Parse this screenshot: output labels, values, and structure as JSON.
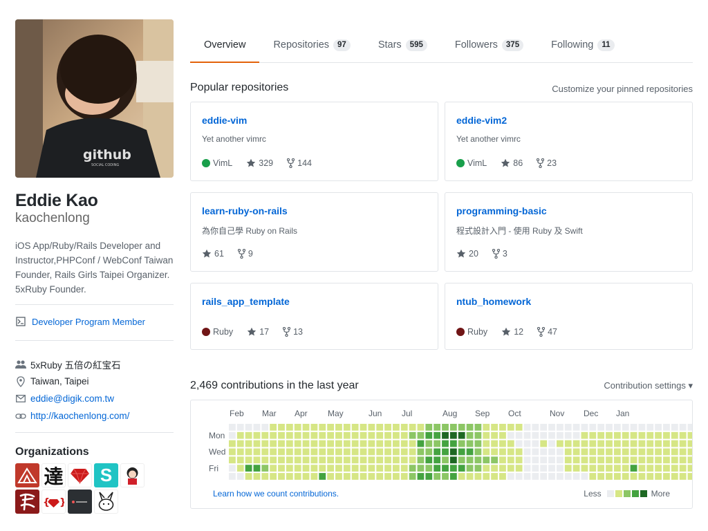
{
  "profile": {
    "fullname": "Eddie Kao",
    "login": "kaochenlong",
    "bio": "iOS App/Ruby/Rails Developer and Instructor,PHPConf / WebConf Taiwan Founder, Rails Girls Taipei Organizer. 5xRuby Founder.",
    "developer_program": "Developer Program Member",
    "avatar_text": "github",
    "avatar_subtext": "SOCIAL CODING",
    "vcard": {
      "company": "5xRuby 五倍の紅宝石",
      "location": "Taiwan, Taipei",
      "email": "eddie@digik.com.tw",
      "website": "http://kaochenlong.com/"
    },
    "organizations_title": "Organizations",
    "organizations": [
      {
        "text": "",
        "color": "#c0392b",
        "icon": "mountain-logo-icon"
      },
      {
        "text": "達",
        "color": "#ffffff",
        "icon": "da-character-logo"
      },
      {
        "text": "",
        "color": "#ffffff",
        "icon": "ruby-gem-icon"
      },
      {
        "text": "S",
        "color": "#20c4c4",
        "icon": "s-logo-icon"
      },
      {
        "text": "",
        "color": "#ffffff",
        "icon": "cartoon-girl-logo"
      },
      {
        "text": "",
        "color": "#8b1a1a",
        "icon": "calligraphy-logo"
      },
      {
        "text": "{ }",
        "color": "#ffffff",
        "icon": "ruby-braces-logo"
      },
      {
        "text": "",
        "color": "#2b2f33",
        "icon": "dark-app-logo"
      },
      {
        "text": "",
        "color": "#ffffff",
        "icon": "rabbit-logo"
      }
    ]
  },
  "tabs": [
    {
      "label": "Overview",
      "count": "",
      "selected": true
    },
    {
      "label": "Repositories",
      "count": "97"
    },
    {
      "label": "Stars",
      "count": "595"
    },
    {
      "label": "Followers",
      "count": "375"
    },
    {
      "label": "Following",
      "count": "11"
    }
  ],
  "pinned": {
    "title": "Popular repositories",
    "customize": "Customize your pinned repositories",
    "repos": [
      {
        "name": "eddie-vim",
        "desc": "Yet another vimrc",
        "lang": "VimL",
        "lang_color": "#199f4b",
        "stars": "329",
        "forks": "144"
      },
      {
        "name": "eddie-vim2",
        "desc": "Yet another vimrc",
        "lang": "VimL",
        "lang_color": "#199f4b",
        "stars": "86",
        "forks": "23"
      },
      {
        "name": "learn-ruby-on-rails",
        "desc": "為你自己學 Ruby on Rails",
        "lang": "",
        "lang_color": "",
        "stars": "61",
        "forks": "9"
      },
      {
        "name": "programming-basic",
        "desc": "程式設計入門 - 使用 Ruby 及 Swift",
        "lang": "",
        "lang_color": "",
        "stars": "20",
        "forks": "3"
      },
      {
        "name": "rails_app_template",
        "desc": "",
        "lang": "Ruby",
        "lang_color": "#701516",
        "stars": "17",
        "forks": "13"
      },
      {
        "name": "ntub_homework",
        "desc": "",
        "lang": "Ruby",
        "lang_color": "#701516",
        "stars": "12",
        "forks": "47"
      }
    ]
  },
  "contributions": {
    "title": "2,469 contributions in the last year",
    "settings": "Contribution settings ▾",
    "learn": "Learn how we count contributions.",
    "less": "Less",
    "more": "More",
    "months": [
      "Feb",
      "Mar",
      "Apr",
      "May",
      "Jun",
      "Jul",
      "Aug",
      "Sep",
      "Oct",
      "Nov",
      "Dec",
      "Jan"
    ],
    "days": [
      "Mon",
      "Wed",
      "Fri"
    ],
    "colors": [
      "#ebedf0",
      "#d6e685",
      "#8cc665",
      "#44a340",
      "#1e6823"
    ],
    "grid": [
      "0000011111111111111111112222222111110000000000000000000000",
      "0111111111111111111111223344422111000000000111111111111111",
      "1111111111111111111111132233222111100010111111111111111112",
      "1111111111111111111111122334332111110000011111111111111111",
      "1111111111111111111111123324222221110000011111111111111111",
      "0133211111111111111111222333322111110000011111111311111111",
      "0011111111131111111111233223111111000000000011111111111110"
    ]
  }
}
